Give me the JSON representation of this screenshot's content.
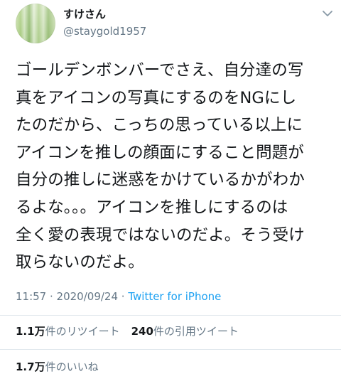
{
  "user": {
    "display_name": "すけさん",
    "handle": "@staygold1957"
  },
  "tweet": {
    "lines": [
      "ゴールデンボンバーでさえ、自分達の写",
      "真をアイコンの写真にするのをNGにし",
      "たのだから、こっちの思っている以上に",
      "アイコンを推しの顔面にすること問題が",
      "自分の推しに迷惑をかけているかがわか",
      "るよな。。。アイコンを推しにするのは",
      "全く愛の表現ではないのだよ。そう受け",
      "取らないのだよ。"
    ],
    "time": "11:57",
    "date": "2020/09/24",
    "separator1": " · ",
    "separator2": " · ",
    "source": "Twitter for iPhone"
  },
  "stats": {
    "retweets_count": "1.1万",
    "retweets_label": "件のリツイート",
    "quotes_count": "240",
    "quotes_label": "件の引用ツイート",
    "likes_count": "1.7万",
    "likes_label": "件のいいね"
  },
  "icons": {
    "more": "chevron-down-icon"
  },
  "colors": {
    "text": "#14171a",
    "secondary": "#657786",
    "link": "#1da1f2",
    "divider": "#e1e8ed"
  }
}
